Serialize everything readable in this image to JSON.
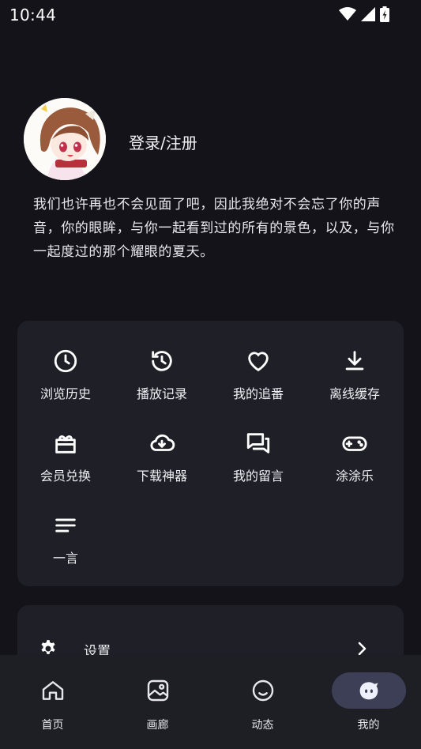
{
  "status_bar": {
    "time": "10:44"
  },
  "profile": {
    "login_label": "登录/注册"
  },
  "quote": "我们也许再也不会见面了吧，因此我绝对不会忘了你的声音，你的眼眸，与你一起看到过的所有的景色，以及，与你一起度过的那个耀眼的夏天。",
  "menu": [
    {
      "label": "浏览历史",
      "icon": "clock-icon"
    },
    {
      "label": "播放记录",
      "icon": "history-icon"
    },
    {
      "label": "我的追番",
      "icon": "heart-icon"
    },
    {
      "label": "离线缓存",
      "icon": "download-icon"
    },
    {
      "label": "会员兑换",
      "icon": "gift-icon"
    },
    {
      "label": "下载神器",
      "icon": "cloud-download-icon"
    },
    {
      "label": "我的留言",
      "icon": "message-icon"
    },
    {
      "label": "涂涂乐",
      "icon": "gamepad-icon"
    },
    {
      "label": "一言",
      "icon": "lines-icon"
    }
  ],
  "settings": {
    "label": "设置",
    "icon": "gear-icon"
  },
  "bottom_nav": [
    {
      "label": "首页",
      "icon": "home-icon"
    },
    {
      "label": "画廊",
      "icon": "image-icon"
    },
    {
      "label": "动态",
      "icon": "smile-icon"
    },
    {
      "label": "我的",
      "icon": "mascot-icon",
      "active": true
    }
  ],
  "colors": {
    "background": "#131319",
    "card": "#1f1f27",
    "nav_background": "#1e1e25",
    "nav_active_pill": "#3d3f56",
    "text": "#ececf2"
  }
}
